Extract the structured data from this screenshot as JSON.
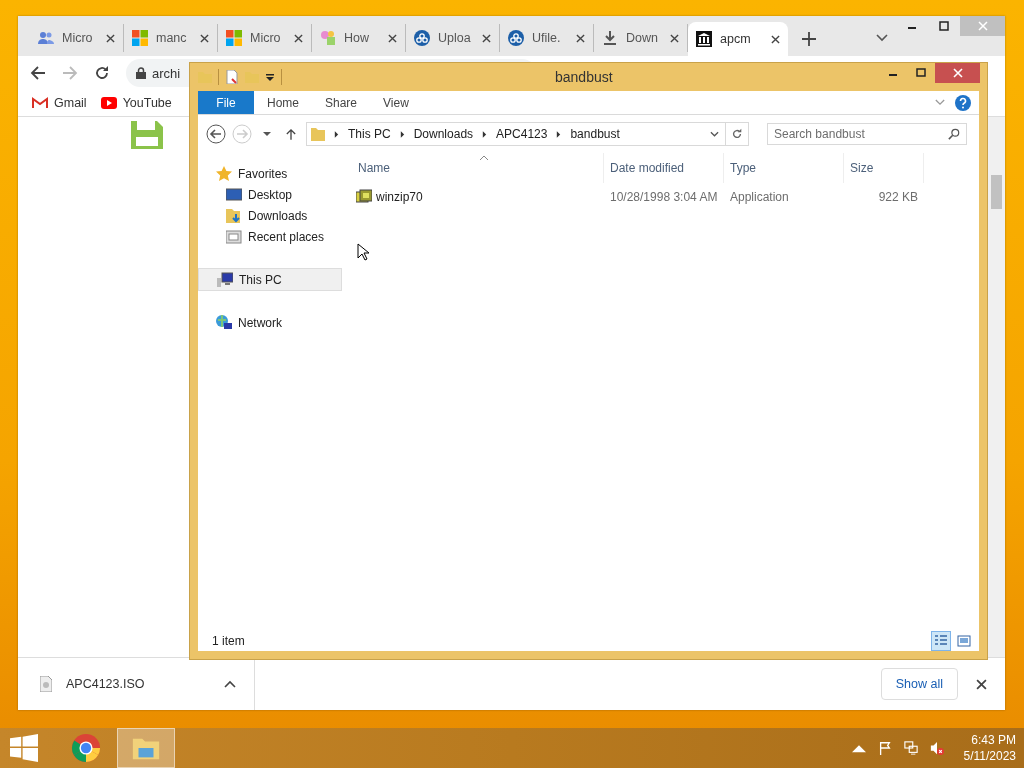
{
  "browser": {
    "tabs": [
      {
        "title": "Micro",
        "kind": "people",
        "selected": false
      },
      {
        "title": "manc",
        "kind": "windows",
        "selected": false
      },
      {
        "title": "Micro",
        "kind": "windows",
        "selected": false
      },
      {
        "title": "How",
        "kind": "colorful",
        "selected": false
      },
      {
        "title": "Uploa",
        "kind": "cloud",
        "selected": false
      },
      {
        "title": "Ufile.",
        "kind": "cloud",
        "selected": false
      },
      {
        "title": "Down",
        "kind": "download",
        "selected": false
      },
      {
        "title": "apcm",
        "kind": "museum",
        "selected": true
      }
    ],
    "address": "archi",
    "bookmarks": [
      {
        "label": "Gmail",
        "kind": "gmail"
      },
      {
        "label": "YouTube",
        "kind": "youtube"
      }
    ],
    "download": {
      "file": "APC4123.ISO"
    },
    "show_all": "Show all"
  },
  "explorer": {
    "title": "bandbust",
    "ribbon_tabs": [
      {
        "label": "File",
        "kind": "file"
      },
      {
        "label": "Home",
        "kind": "tab"
      },
      {
        "label": "Share",
        "kind": "tab"
      },
      {
        "label": "View",
        "kind": "tab"
      }
    ],
    "path": [
      "This PC",
      "Downloads",
      "APC4123",
      "bandbust"
    ],
    "search": {
      "placeholder": "Search bandbust"
    },
    "nav": [
      {
        "label": "Favorites",
        "kind": "star",
        "selected": false,
        "children": [
          {
            "label": "Desktop",
            "kind": "desktop",
            "selected": false
          },
          {
            "label": "Downloads",
            "kind": "downloads",
            "selected": false
          },
          {
            "label": "Recent places",
            "kind": "recent",
            "selected": false
          }
        ]
      },
      {
        "label": "This PC",
        "kind": "pc",
        "selected": true
      },
      {
        "label": "Network",
        "kind": "network",
        "selected": false
      }
    ],
    "columns": [
      "Name",
      "Date modified",
      "Type",
      "Size"
    ],
    "rows": [
      {
        "name": "winzip70",
        "date_modified": "10/28/1998 3:04 AM",
        "type": "Application",
        "size": "922 KB"
      }
    ],
    "status": "1 item"
  },
  "taskbar": {
    "time": "6:43 PM",
    "date": "5/11/2023"
  }
}
